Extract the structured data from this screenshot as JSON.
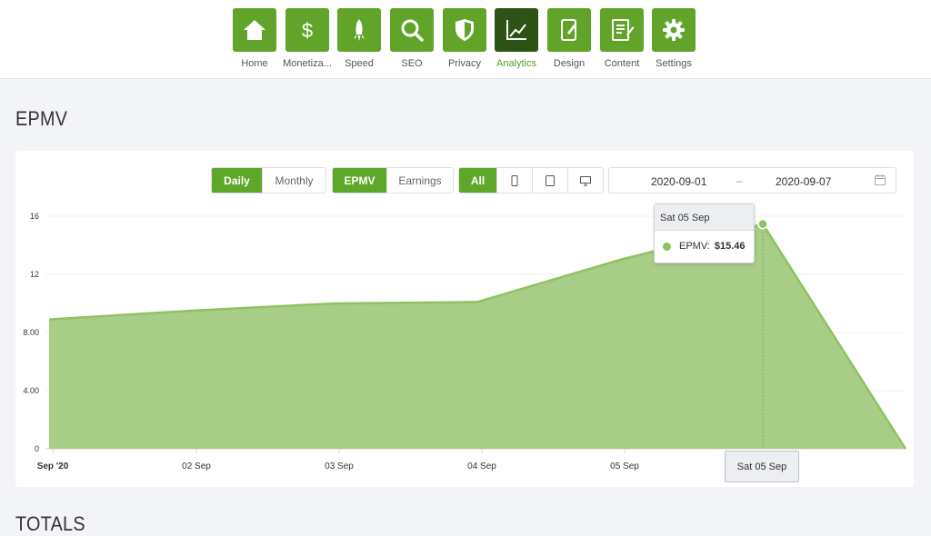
{
  "nav": {
    "items": [
      {
        "label": "Home",
        "icon": "home-icon"
      },
      {
        "label": "Monetiza...",
        "icon": "dollar-icon"
      },
      {
        "label": "Speed",
        "icon": "rocket-icon"
      },
      {
        "label": "SEO",
        "icon": "magnifier-icon"
      },
      {
        "label": "Privacy",
        "icon": "shield-icon"
      },
      {
        "label": "Analytics",
        "icon": "line-chart-icon",
        "active": true
      },
      {
        "label": "Design",
        "icon": "design-tablet-icon"
      },
      {
        "label": "Content",
        "icon": "document-edit-icon"
      },
      {
        "label": "Settings",
        "icon": "gear-icon"
      }
    ],
    "colors": {
      "button": "#62a42a",
      "active_button": "#2f5216",
      "active_label": "#5c9a26"
    }
  },
  "epmv_section": {
    "title": "EPMV"
  },
  "totals_section": {
    "title": "TOTALS"
  },
  "controls": {
    "period": {
      "options": [
        "Daily",
        "Monthly"
      ],
      "selected": "Daily"
    },
    "metric": {
      "options": [
        "EPMV",
        "Earnings"
      ],
      "selected": "EPMV"
    },
    "device": {
      "options": [
        "All",
        "mobile-icon",
        "tablet-icon",
        "desktop-icon"
      ],
      "selected": "All"
    },
    "date_range": {
      "start": "2020-09-01",
      "separator": "–",
      "end": "2020-09-07",
      "icon": "calendar-icon"
    }
  },
  "tooltip": {
    "title": "Sat 05 Sep",
    "series_label": "EPMV:",
    "value": "$15.46"
  },
  "crosshair_label": "Sat 05 Sep",
  "chart_data": {
    "type": "area",
    "x": [
      "2020-09-01",
      "2020-09-02",
      "2020-09-03",
      "2020-09-04",
      "2020-09-05",
      "2020-09-06",
      "2020-09-07"
    ],
    "x_tick_labels": [
      "Sep '20",
      "02 Sep",
      "03 Sep",
      "04 Sep",
      "05 Sep",
      "Sat 05 Sep"
    ],
    "y_tick_labels": [
      "0",
      "4.00",
      "8.00",
      "12",
      "16"
    ],
    "y_ticks": [
      0,
      4,
      8,
      12,
      16
    ],
    "series": [
      {
        "values": [
          8.9,
          9.5,
          10.0,
          10.1,
          13.0,
          15.46,
          0
        ],
        "color": "#8fc261"
      }
    ],
    "ylim": [
      0,
      16
    ],
    "grid": true,
    "highlighted_index": 5
  }
}
